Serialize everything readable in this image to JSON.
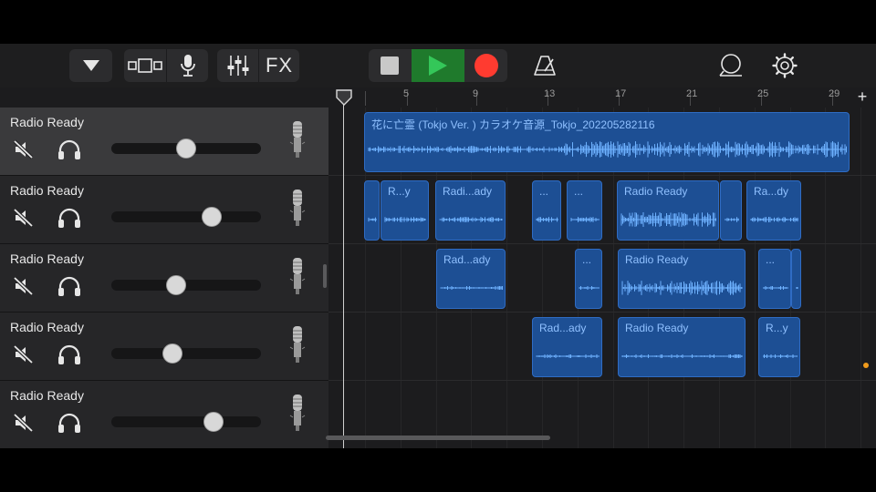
{
  "toolbar": {
    "buttons": [
      {
        "name": "dropdown",
        "icon": "triangle-down-icon"
      },
      {
        "name": "track-view",
        "icon": "tracks-view-icon"
      },
      {
        "name": "instrument-mic",
        "icon": "microphone-icon"
      },
      {
        "name": "mixer",
        "icon": "sliders-icon"
      },
      {
        "name": "fx",
        "label": "FX"
      },
      {
        "name": "stop",
        "icon": "stop-icon"
      },
      {
        "name": "play",
        "icon": "play-icon"
      },
      {
        "name": "record",
        "icon": "record-icon"
      },
      {
        "name": "metronome",
        "icon": "metronome-icon"
      },
      {
        "name": "loop-browser",
        "icon": "loop-icon"
      },
      {
        "name": "settings",
        "icon": "gear-icon"
      }
    ],
    "fx_label": "FX"
  },
  "colors": {
    "region_fill": "#1d4f94",
    "region_border": "#2f6cc4",
    "region_text": "#8fc0ff",
    "waveform": "#6eb2ff",
    "play_green": "#34c759",
    "record_red": "#ff3b30",
    "marker_orange": "#f19b1c"
  },
  "ruler": {
    "labels": [
      "5",
      "9",
      "13",
      "17",
      "21",
      "25",
      "29"
    ],
    "add_label": "+"
  },
  "tracks": [
    {
      "name": "Radio Ready",
      "volume": 0.5,
      "selected": true
    },
    {
      "name": "Radio Ready",
      "volume": 0.67,
      "selected": false
    },
    {
      "name": "Radio Ready",
      "volume": 0.43,
      "selected": false
    },
    {
      "name": "Radio Ready",
      "volume": 0.41,
      "selected": false
    },
    {
      "name": "Radio Ready",
      "volume": 0.68,
      "selected": false
    }
  ],
  "regions": [
    {
      "lane": 0,
      "label": "花に亡霊 (Tokjo Ver. ) カラオケ音源_Tokjo_202205282116",
      "wave": "dense"
    },
    {
      "lane": 1,
      "label": "",
      "wave": "sparse"
    },
    {
      "lane": 1,
      "label": "R...y",
      "wave": "sparse"
    },
    {
      "lane": 1,
      "label": "Radi...ady",
      "wave": "sparse"
    },
    {
      "lane": 1,
      "label": "...",
      "wave": "sparse"
    },
    {
      "lane": 1,
      "label": "...",
      "wave": "sparse"
    },
    {
      "lane": 1,
      "label": "Radio Ready",
      "wave": "medium"
    },
    {
      "lane": 1,
      "label": "",
      "wave": "sparse"
    },
    {
      "lane": 1,
      "label": "Ra...dy",
      "wave": "sparse"
    },
    {
      "lane": 2,
      "label": "Rad...ady",
      "wave": "flat"
    },
    {
      "lane": 2,
      "label": "...",
      "wave": "flat"
    },
    {
      "lane": 2,
      "label": "Radio Ready",
      "wave": "medium"
    },
    {
      "lane": 2,
      "label": "...",
      "wave": "flat"
    },
    {
      "lane": 2,
      "label": "",
      "wave": "flat"
    },
    {
      "lane": 3,
      "label": "Rad...ady",
      "wave": "flat"
    },
    {
      "lane": 3,
      "label": "Radio Ready",
      "wave": "flat"
    },
    {
      "lane": 3,
      "label": "R...y",
      "wave": "flat"
    }
  ]
}
